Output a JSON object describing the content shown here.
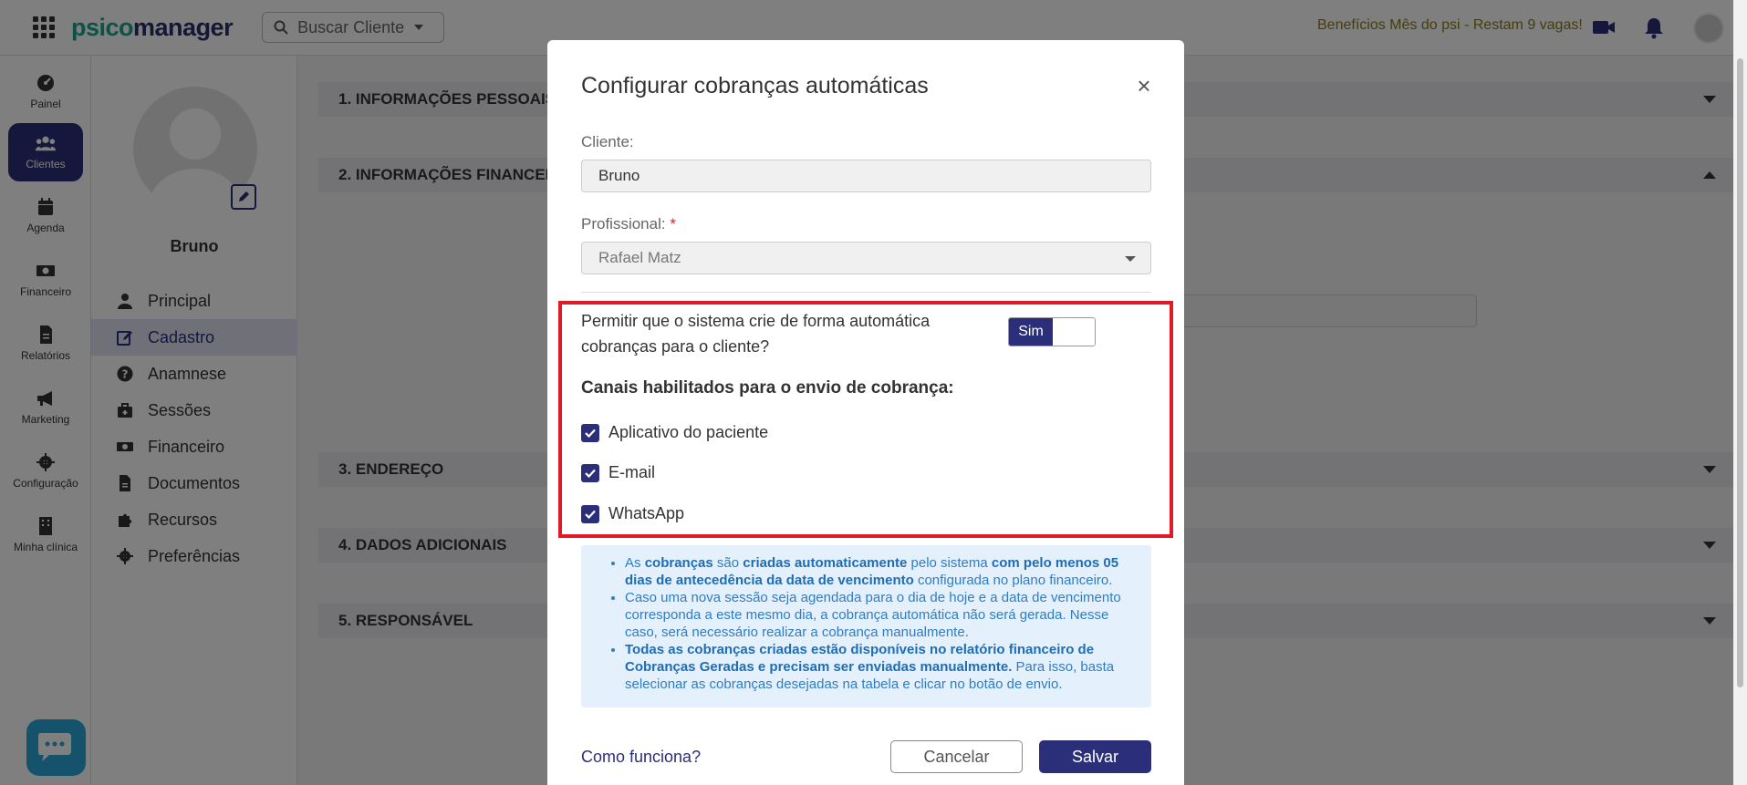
{
  "topbar": {
    "logo_part1": "psico",
    "logo_part2": "manager",
    "search_label": "Buscar Cliente",
    "promo": "Benefícios Mês do psi - Restam 9 vagas!"
  },
  "sidebar": {
    "items": [
      {
        "label": "Painel",
        "icon": "dashboard-icon"
      },
      {
        "label": "Clientes",
        "icon": "users-icon",
        "active": true
      },
      {
        "label": "Agenda",
        "icon": "calendar-icon"
      },
      {
        "label": "Financeiro",
        "icon": "money-icon"
      },
      {
        "label": "Relatórios",
        "icon": "file-icon"
      },
      {
        "label": "Marketing",
        "icon": "megaphone-icon"
      },
      {
        "label": "Configuração",
        "icon": "gear-icon"
      },
      {
        "label": "Minha clínica",
        "icon": "building-icon"
      }
    ]
  },
  "profile": {
    "name": "Bruno",
    "menu": [
      {
        "label": "Principal",
        "icon": "user-icon"
      },
      {
        "label": "Cadastro",
        "icon": "edit-icon",
        "active": true
      },
      {
        "label": "Anamnese",
        "icon": "question-icon"
      },
      {
        "label": "Sessões",
        "icon": "briefcase-icon"
      },
      {
        "label": "Financeiro",
        "icon": "money-icon"
      },
      {
        "label": "Documentos",
        "icon": "document-icon"
      },
      {
        "label": "Recursos",
        "icon": "puzzle-icon"
      },
      {
        "label": "Preferências",
        "icon": "gear-icon"
      }
    ]
  },
  "sections": [
    "1. INFORMAÇÕES PESSOAIS",
    "2. INFORMAÇÕES FINANCEIRAS",
    "3. ENDEREÇO",
    "4. DADOS ADICIONAIS",
    "5. RESPONSÁVEL"
  ],
  "modal": {
    "title": "Configurar cobranças automáticas",
    "client_label": "Cliente:",
    "client_value": "Bruno",
    "professional_label": "Profissional:",
    "required_mark": "*",
    "professional_value": "Rafael Matz",
    "question": "Permitir que o sistema crie de forma automática cobranças para o cliente?",
    "toggle_label": "Sim",
    "channels_title": "Canais habilitados para o envio de cobrança:",
    "channels": [
      "Aplicativo do paciente",
      "E-mail",
      "WhatsApp"
    ],
    "info": {
      "b1": {
        "t1": "As ",
        "b1": "cobranças",
        "t2": " são ",
        "b2": "criadas automaticamente",
        "t3": " pelo sistema ",
        "b3": "com pelo menos 05 dias de antecedência da data de vencimento",
        "t4": " configurada no plano financeiro."
      },
      "b2": "Caso uma nova sessão seja agendada para o dia de hoje e a data de vencimento corresponda a este mesmo dia, a cobrança automática não será gerada. Nesse caso, será necessário realizar a cobrança manualmente.",
      "b3": {
        "bold": "Todas as cobranças criadas estão disponíveis no relatório financeiro de Cobranças Geradas e precisam ser enviadas manualmente.",
        "rest": " Para isso, basta selecionar as cobranças desejadas na tabela e clicar no botão de envio."
      }
    },
    "help_link": "Como funciona?",
    "cancel": "Cancelar",
    "save": "Salvar"
  },
  "colors": {
    "primary": "#2b2f7a",
    "highlight_border": "#e01b24",
    "info_bg": "#e4f0fb",
    "info_text": "#2f7dc4"
  }
}
